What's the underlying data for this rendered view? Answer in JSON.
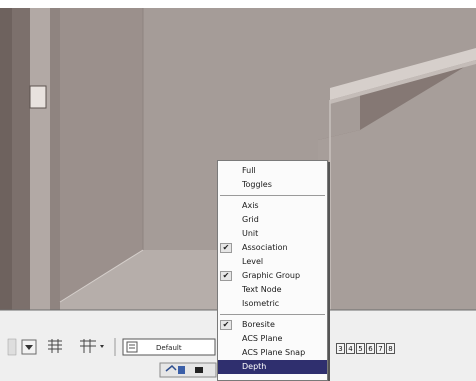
{
  "toolbar": {
    "level_selector_value": "Default"
  },
  "page_tabs": [
    "3",
    "4",
    "5",
    "6",
    "7",
    "8"
  ],
  "context_menu": {
    "groups": [
      [
        {
          "label": "Full",
          "checked": false
        },
        {
          "label": "Toggles",
          "checked": false
        }
      ],
      [
        {
          "label": "Axis",
          "checked": false
        },
        {
          "label": "Grid",
          "checked": false
        },
        {
          "label": "Unit",
          "checked": false
        },
        {
          "label": "Association",
          "checked": true
        },
        {
          "label": "Level",
          "checked": false
        },
        {
          "label": "Graphic Group",
          "checked": true
        },
        {
          "label": "Text Node",
          "checked": false
        },
        {
          "label": "Isometric",
          "checked": false
        }
      ],
      [
        {
          "label": "Boresite",
          "checked": true
        },
        {
          "label": "ACS Plane",
          "checked": false
        },
        {
          "label": "ACS Plane Snap",
          "checked": false
        },
        {
          "label": "Depth",
          "checked": false,
          "highlighted": true
        }
      ]
    ],
    "check_glyph": "✔"
  },
  "colors": {
    "viewport_background": "#857874",
    "floor": "#b6aeaa",
    "wall": "#a79e9a",
    "highlight": "#2f2f6e"
  }
}
